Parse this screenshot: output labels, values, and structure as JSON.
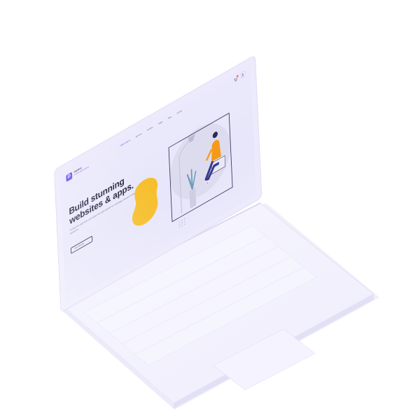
{
  "brand": {
    "name": "DigiWeb",
    "tagline": "Creative Digital Agency",
    "mark": "D",
    "accent": "#6b4ef6",
    "highlight": "#f6be2a"
  },
  "nav": {
    "items": [
      "Digital Agency",
      "Services",
      "Portfolio",
      "Pages",
      "Blog",
      "Contact"
    ],
    "icons": [
      "cart-icon",
      "user-icon"
    ]
  },
  "hero": {
    "headline": "Build stunning\nwebsites & apps.",
    "description": "Create live segments and target the right people for messages based on their behaviors.",
    "cta_label": "View Services",
    "cta_icon": "arrow-right-icon"
  }
}
